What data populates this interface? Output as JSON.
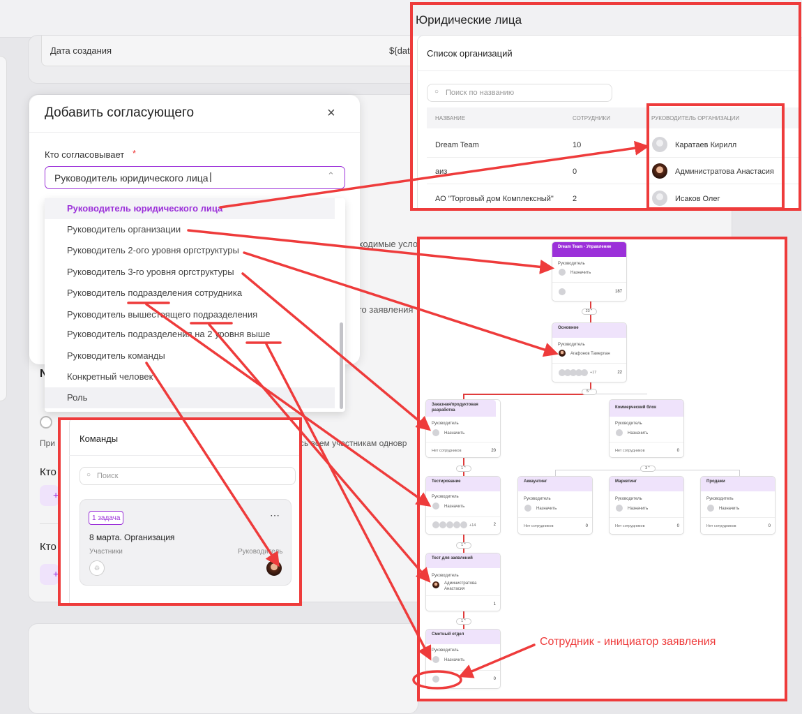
{
  "bg": {
    "date_label": "Дата создания",
    "date_value": "${dat",
    "frag_conditions": "ходимые усло",
    "frag_application": "го заявления",
    "frag_n": "N",
    "frag_pri": "При",
    "frag_all": "сь всем участникам одновр",
    "frag_kto1": "Кто",
    "frag_kto2": "Кто",
    "frag_plus1": "+",
    "frag_plus2": "+"
  },
  "modal": {
    "title": "Добавить согласующего",
    "field_label": "Кто согласовывает",
    "required_mark": "*",
    "selected_value": "Руководитель юридического лица",
    "options": [
      "Руководитель юридического лица",
      "Руководитель организации",
      "Руководитель 2-ого уровня оргструктуры",
      "Руководитель 3-го уровня оргструктуры",
      "Руководитель подразделения сотрудника",
      "Руководитель вышестоящего подразделения",
      "Руководитель подразделения на 2 уровня выше",
      "Руководитель команды",
      "Конкретный человек",
      "Роль"
    ]
  },
  "legal": {
    "title": "Юридические лица",
    "subtitle": "Список организаций",
    "search_placeholder": "Поиск по названию",
    "columns": [
      "НАЗВАНИЕ",
      "СОТРУДНИКИ",
      "РУКОВОДИТЕЛЬ ОРГАНИЗАЦИИ"
    ],
    "rows": [
      {
        "name": "Dream Team",
        "count": "10",
        "head": "Каратаев Кирилл",
        "avatar": "gray"
      },
      {
        "name": "аиз",
        "count": "0",
        "head": "Администратова Анастасия",
        "avatar": "photo"
      },
      {
        "name": "АО \"Торговый дом Комплексный\"",
        "count": "2",
        "head": "Исаков Олег",
        "avatar": "gray"
      }
    ]
  },
  "teams": {
    "title": "Команды",
    "search_placeholder": "Поиск",
    "badge": "1 задача",
    "card_title": "8 марта. Организация",
    "participants_label": "Участники",
    "leader_label": "Руководитель"
  },
  "org": {
    "head_label": "Руководитель",
    "assign_label": "Назначить",
    "no_staff_label": "Нет сотрудников",
    "nodes": {
      "top": {
        "title": "Dream Team - Управление",
        "count": "187"
      },
      "main": {
        "title": "Основное",
        "head": "Агафонов Тамерлан",
        "extra": "+17",
        "count": "22"
      },
      "custom": {
        "title": "Заказная/продуктовая разработка",
        "count": "20"
      },
      "commerce": {
        "title": "Коммерческий блок",
        "count": "0"
      },
      "testing": {
        "title": "Тестирование",
        "extra": "+14",
        "count": "2"
      },
      "accounting": {
        "title": "Аккаунтинг",
        "count": "0"
      },
      "marketing": {
        "title": "Маркетинг",
        "count": "0"
      },
      "sales": {
        "title": "Продажи",
        "count": "0"
      },
      "apps": {
        "title": "Тест для заявлений",
        "head": "Администратова Анастасия",
        "count": "1"
      },
      "estimate": {
        "title": "Сметный отдел",
        "count": "0"
      }
    },
    "pills": {
      "p1": "23",
      "p2": "5",
      "p3": "1",
      "p4": "3",
      "p5": "1",
      "p6": "1"
    }
  },
  "annotation": "Сотрудник - инициатор заявления",
  "colors": {
    "accent": "#9b30d9",
    "red": "#ee3b3b",
    "node_head": "#efe3fb"
  }
}
